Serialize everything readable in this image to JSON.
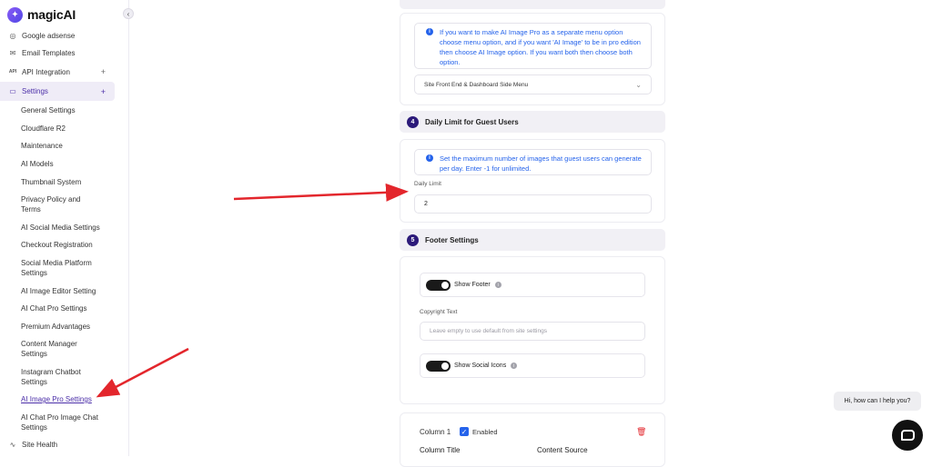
{
  "brand": {
    "name": "magicAI"
  },
  "sidebar": {
    "top_items": [
      {
        "label": "Google adsense",
        "icon": "adsense-icon"
      },
      {
        "label": "Email Templates",
        "icon": "mail-icon"
      },
      {
        "label": "API Integration",
        "icon": "api-icon",
        "icon_text": "API",
        "has_plus": true
      }
    ],
    "settings": {
      "label": "Settings",
      "icon": "laptop-icon"
    },
    "sub_items": [
      "General Settings",
      "Cloudflare R2",
      "Maintenance",
      "AI Models",
      "Thumbnail System",
      "Privacy Policy and Terms",
      "AI Social Media Settings",
      "Checkout Registration",
      "Social Media Platform Settings",
      "AI Image Editor Setting",
      "AI Chat Pro Settings",
      "Premium Advantages",
      "Content Manager Settings",
      "Instagram Chatbot Settings",
      "AI Image Pro Settings",
      "AI Chat Pro Image Chat Settings"
    ],
    "site_health": {
      "label": "Site Health",
      "icon": "pulse-icon"
    },
    "active_sub_item": "AI Image Pro Settings"
  },
  "section3": {
    "info": "If you want to make AI Image Pro as a separate menu option choose menu option, and if you want 'AI Image' to be in pro edition then choose AI Image option. If you want both then choose both option.",
    "select_value": "Site Front End & Dashboard Side Menu"
  },
  "section4": {
    "number": "4",
    "title": "Daily Limit for Guest Users",
    "info": "Set the maximum number of images that guest users can generate per day. Enter -1 for unlimited.",
    "field_label": "Daily Limit",
    "field_value": "2"
  },
  "section5": {
    "number": "5",
    "title": "Footer Settings",
    "show_footer_label": "Show Footer",
    "copyright_label": "Copyright Text",
    "copyright_placeholder": "Leave empty to use default from site settings",
    "show_social_label": "Show Social Icons"
  },
  "columns": {
    "column1_label": "Column 1",
    "enabled_label": "Enabled",
    "column_title_label": "Column Title",
    "content_source_label": "Content Source"
  },
  "chat": {
    "greeting": "Hi, how can I help you?"
  },
  "colors": {
    "accent": "#4b2ea8",
    "info_blue": "#2563eb",
    "arrow_red": "#e3262c",
    "step_badge": "#2c1a7a"
  }
}
